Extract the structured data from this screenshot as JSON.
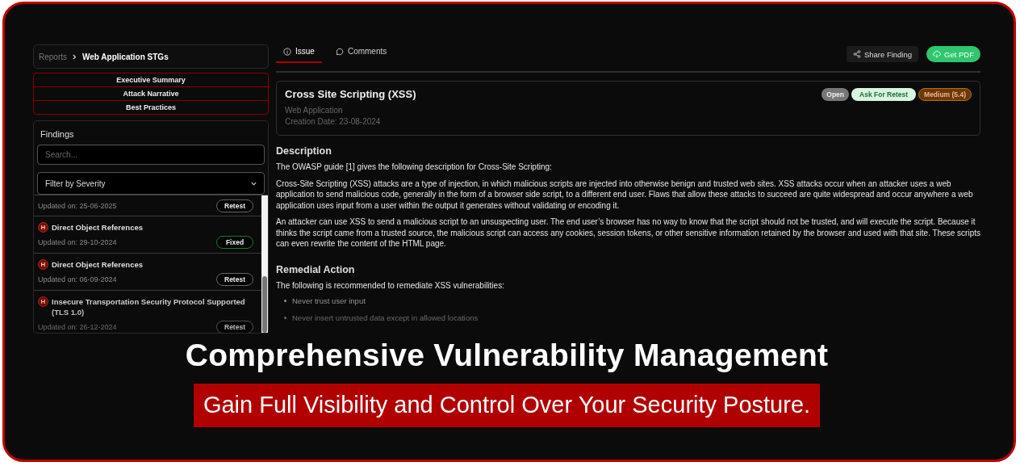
{
  "breadcrumb": {
    "parent": "Reports",
    "current": "Web Application STGs"
  },
  "report_sections": [
    "Executive Summary",
    "Attack Narrative",
    "Best Practices"
  ],
  "findings": {
    "title": "Findings",
    "search": {
      "placeholder": "Search..."
    },
    "filter": {
      "value": "Filter by Severity"
    },
    "items": [
      {
        "updated": "Updated on: 25-06-2025",
        "action": "Retest",
        "kind": "retest"
      },
      {
        "severity": "H",
        "title": "Direct Object References",
        "updated": "Updated on: 29-10-2024",
        "action": "Fixed",
        "kind": "fixed"
      },
      {
        "severity": "H",
        "title": "Direct Object References",
        "updated": "Updated on: 06-09-2024",
        "action": "Retest",
        "kind": "retest"
      },
      {
        "severity": "H",
        "title": "Insecure Transportation Security Protocol Supported (TLS 1.0)",
        "updated": "Updated on: 26-12-2024",
        "action": "Retest",
        "kind": "retest"
      }
    ]
  },
  "tabs": [
    {
      "label": "Issue",
      "selected": true,
      "kind": "info"
    },
    {
      "label": "Comments",
      "selected": false,
      "kind": "comment"
    }
  ],
  "actions": [
    {
      "label": "Share Finding",
      "kind": "share"
    },
    {
      "label": "Get PDF",
      "kind": "pdf"
    }
  ],
  "issue": {
    "title": "Cross Site Scripting (XSS)",
    "category": "Web Application",
    "created": "Creation Date: 23-08-2024",
    "badges": [
      {
        "label": "Open",
        "kind": "status"
      },
      {
        "label": "Ask For Retest",
        "kind": "retest"
      },
      {
        "label": "Medium (5.4)",
        "kind": "medium"
      }
    ]
  },
  "sections": [
    {
      "heading": "Description",
      "paragraphs": [
        "The OWASP guide [1] gives the following description for Cross-Site Scripting:",
        "Cross-Site Scripting (XSS) attacks are a type of injection, in which malicious scripts are injected into otherwise benign and trusted web sites. XSS attacks occur when an attacker uses a web application to send malicious code, generally in the form of a browser side script, to a different end user. Flaws that allow these attacks to succeed are quite widespread and occur anywhere a web application uses input from a user within the output it generates without validating or encoding it.",
        "An attacker can use XSS to send a malicious script to an unsuspecting user. The end user’s browser has no way to know that the script should not be trusted, and will execute the script. Because it thinks the script came from a trusted source, the malicious script can access any cookies, session tokens, or other sensitive information retained by the browser and used with that site. These scripts can even rewrite the content of the HTML page."
      ]
    },
    {
      "heading": "Remedial Action",
      "paragraphs": [
        "The following is recommended to remediate XSS vulnerabilities:"
      ],
      "bullets": [
        "Never trust user input",
        "Never insert untrusted data except in allowed locations"
      ]
    }
  ],
  "headline": "Comprehensive Vulnerability Management",
  "subheadline": "Gain Full Visibility and Control Over Your Security Posture."
}
